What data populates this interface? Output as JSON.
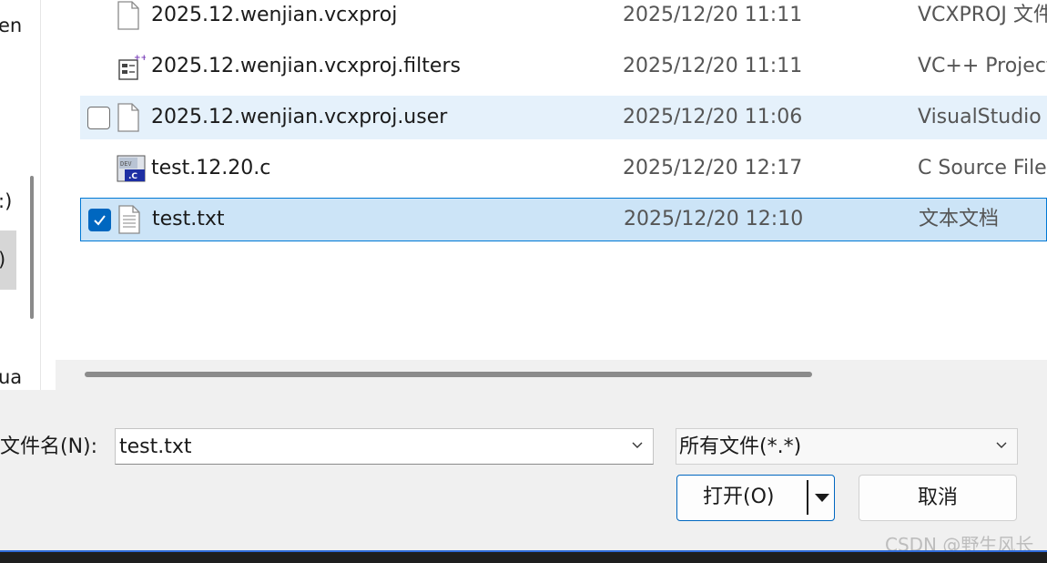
{
  "nav": {
    "items": [
      {
        "label": "en"
      },
      {
        "label": ":)"
      },
      {
        "label": ")"
      },
      {
        "label": "ua"
      }
    ]
  },
  "files": [
    {
      "name": "2025.12.wenjian.vcxproj",
      "date": "2025/12/20 11:11",
      "type": "VCXPROJ 文件",
      "icon": "blank-file-icon",
      "state": "normal",
      "checked": false
    },
    {
      "name": "2025.12.wenjian.vcxproj.filters",
      "date": "2025/12/20 11:11",
      "type": "VC++ Project",
      "icon": "vc-filters-icon",
      "state": "normal",
      "checked": false
    },
    {
      "name": "2025.12.wenjian.vcxproj.user",
      "date": "2025/12/20 11:06",
      "type": "VisualStudio",
      "icon": "blank-file-icon",
      "state": "hover",
      "checked": false
    },
    {
      "name": "test.12.20.c",
      "date": "2025/12/20 12:17",
      "type": "C Source File",
      "icon": "dev-c-file-icon",
      "state": "normal",
      "checked": false
    },
    {
      "name": "test.txt",
      "date": "2025/12/20 12:10",
      "type": "文本文档",
      "icon": "text-file-icon",
      "state": "selected",
      "checked": true
    }
  ],
  "filename": {
    "label": "文件名(N):",
    "value": "test.txt"
  },
  "filter": {
    "selected": "所有文件(*.*)"
  },
  "buttons": {
    "open": "打开(O)",
    "cancel": "取消"
  },
  "watermark": "CSDN @野生风长",
  "colors": {
    "accent": "#0067c0",
    "hover_row": "#e5f1fb",
    "selected_row": "#cce4f7",
    "selected_border": "#0078d4"
  }
}
